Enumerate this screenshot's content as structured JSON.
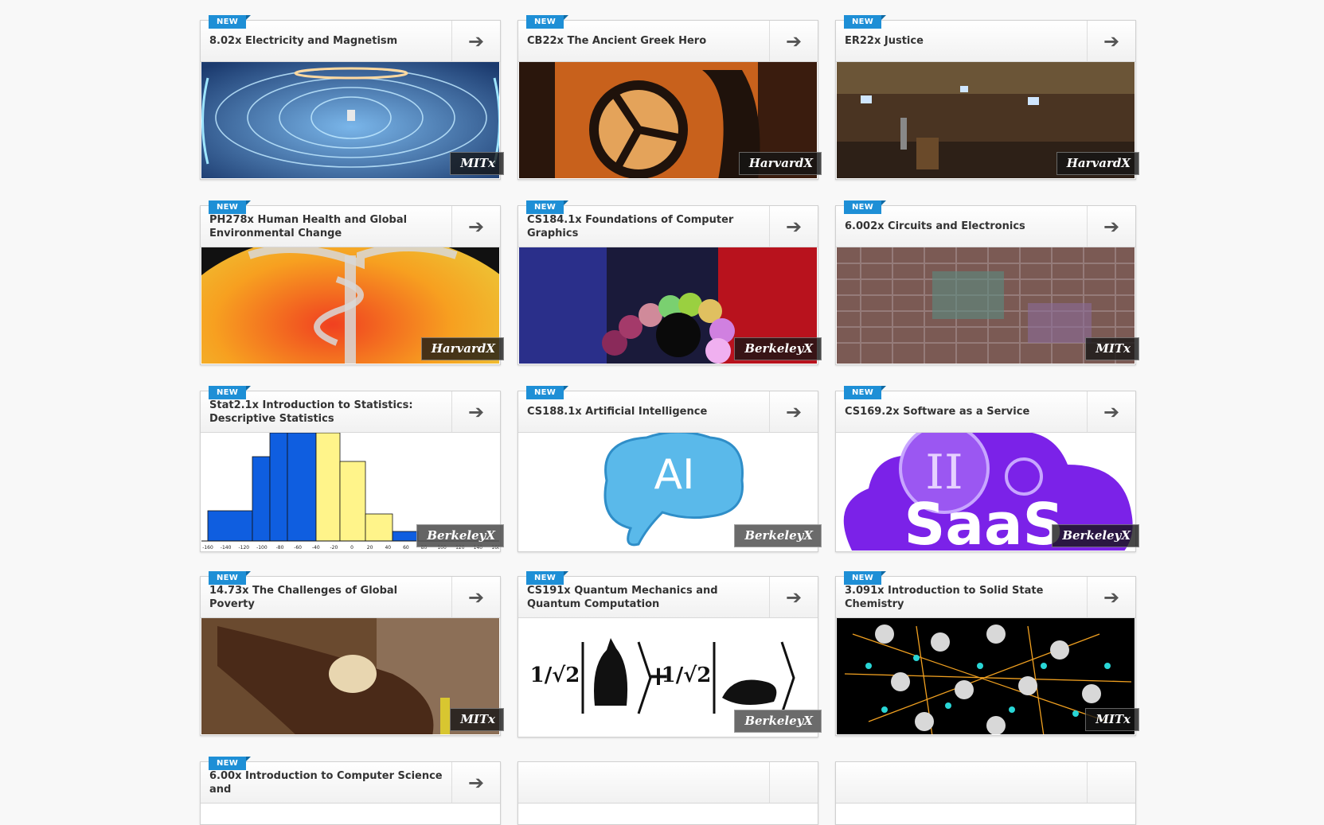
{
  "badge_label": "NEW",
  "arrow_glyph": "➔",
  "courses": [
    {
      "title": "8.02x Electricity and Magnetism",
      "school": "MITx"
    },
    {
      "title": "CB22x The Ancient Greek Hero",
      "school": "HarvardX"
    },
    {
      "title": "ER22x Justice",
      "school": "HarvardX"
    },
    {
      "title": "PH278x Human Health and Global Environmental Change",
      "school": "HarvardX"
    },
    {
      "title": "CS184.1x Foundations of Computer Graphics",
      "school": "BerkeleyX"
    },
    {
      "title": "6.002x Circuits and Electronics",
      "school": "MITx"
    },
    {
      "title": "Stat2.1x Introduction to Statistics: Descriptive Statistics",
      "school": "BerkeleyX"
    },
    {
      "title": "CS188.1x Artificial Intelligence",
      "school": "BerkeleyX"
    },
    {
      "title": "CS169.2x Software as a Service",
      "school": "BerkeleyX"
    },
    {
      "title": "14.73x The Challenges of Global Poverty",
      "school": "MITx"
    },
    {
      "title": "CS191x Quantum Mechanics and Quantum Computation",
      "school": "BerkeleyX"
    },
    {
      "title": "3.091x Introduction to Solid State Chemistry",
      "school": "MITx"
    },
    {
      "title": "6.00x Introduction to Computer Science and",
      "school": ""
    },
    {
      "title": "",
      "school": ""
    },
    {
      "title": "",
      "school": ""
    }
  ],
  "stat_axis_ticks": [
    "-160",
    "-140",
    "-120",
    "-100",
    "-80",
    "-60",
    "-40",
    "-20",
    "0",
    "20",
    "40",
    "60",
    "80",
    "100",
    "120",
    "140",
    "160"
  ],
  "ai_image_text": "AI",
  "saas_image_text": "SaaS",
  "saas_roman_numeral": "II",
  "quantum_fraction": "1/√2",
  "colors": {
    "badge": "#1e8fd6",
    "school_tag": "#141414",
    "title": "#333333"
  }
}
